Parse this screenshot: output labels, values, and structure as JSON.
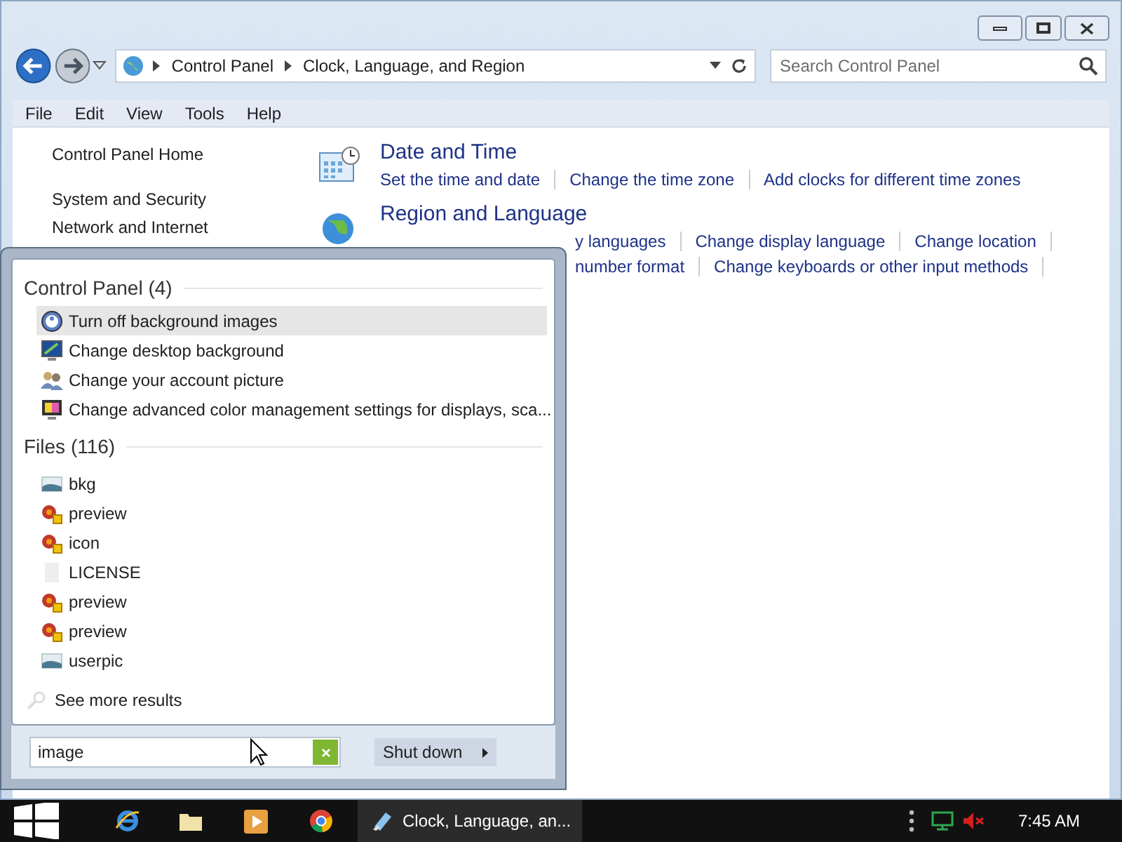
{
  "window": {
    "breadcrumb": [
      "Control Panel",
      "Clock, Language, and Region"
    ],
    "search": {
      "placeholder": "Search Control Panel"
    }
  },
  "menu_bar": [
    "File",
    "Edit",
    "View",
    "Tools",
    "Help"
  ],
  "sidebar": {
    "items": [
      "Control Panel Home",
      "System and Security",
      "Network and Internet"
    ]
  },
  "categories": [
    {
      "title": "Date and Time",
      "kind": "clock",
      "links": [
        [
          "Set the time and date",
          "Change the time zone",
          "Add clocks for different time zones"
        ]
      ]
    },
    {
      "title": "Region and Language",
      "kind": "globe",
      "links": [
        [
          "y languages",
          "Change display language",
          "Change location"
        ],
        [
          "number format",
          "Change keyboards or other input methods"
        ]
      ]
    }
  ],
  "start_menu": {
    "groups": [
      {
        "title": "Control Panel (4)",
        "items": [
          {
            "label": "Turn off background images",
            "kind": "ease",
            "selected": true
          },
          {
            "label": "Change desktop background",
            "kind": "monitor",
            "selected": false
          },
          {
            "label": "Change your account picture",
            "kind": "users",
            "selected": false
          },
          {
            "label": "Change advanced color management settings for displays, sca...",
            "kind": "color",
            "selected": false
          }
        ]
      },
      {
        "title": "Files (116)",
        "items": [
          {
            "label": "bkg",
            "kind": "image",
            "selected": false
          },
          {
            "label": "preview",
            "kind": "paint",
            "selected": false
          },
          {
            "label": "icon",
            "kind": "paint",
            "selected": false
          },
          {
            "label": "LICENSE",
            "kind": "blank",
            "selected": false
          },
          {
            "label": "preview",
            "kind": "paint",
            "selected": false
          },
          {
            "label": "preview",
            "kind": "paint",
            "selected": false
          },
          {
            "label": "userpic",
            "kind": "image",
            "selected": false
          }
        ]
      }
    ],
    "see_more": "See more results",
    "search_value": "image",
    "shutdown": "Shut down"
  },
  "taskbar": {
    "window_button": "Clock, Language, an...",
    "time": "7:45 AM"
  }
}
